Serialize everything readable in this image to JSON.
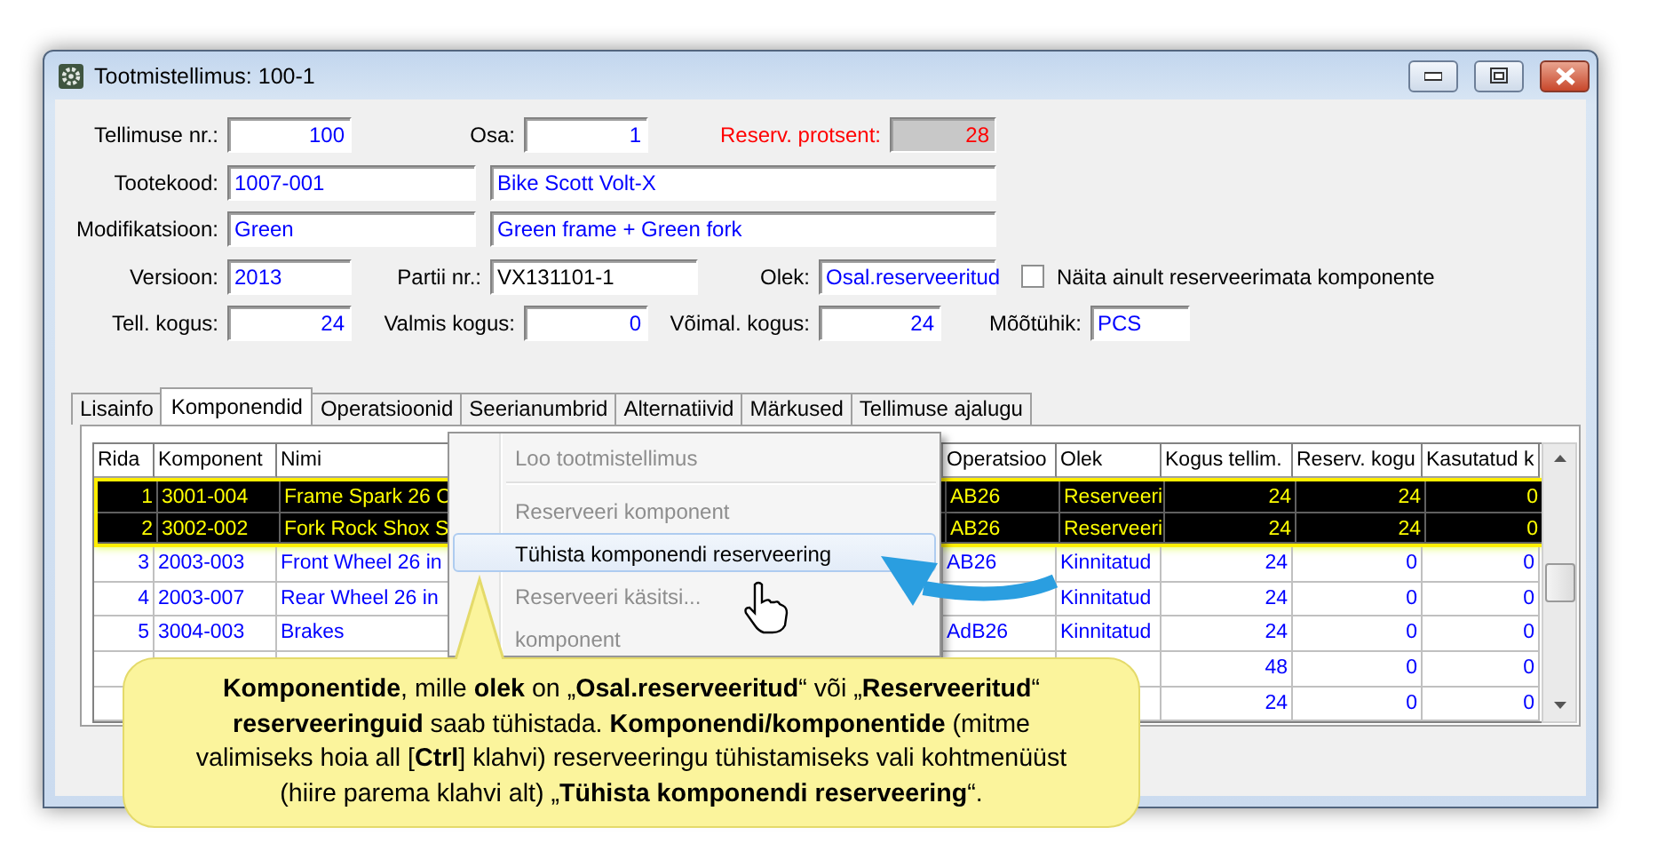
{
  "window": {
    "title": "Tootmistellimus: 100-1"
  },
  "header": {
    "order_no": {
      "label": "Tellimuse nr.:",
      "value": "100"
    },
    "part": {
      "label": "Osa:",
      "value": "1"
    },
    "reserve_percent": {
      "label": "Reserv. protsent:",
      "value": "28"
    },
    "product_code": {
      "label": "Tootekood:",
      "value": "1007-001"
    },
    "product_name": {
      "value": "Bike Scott Volt-X"
    },
    "modification": {
      "label": "Modifikatsioon:",
      "value": "Green"
    },
    "modification_desc": {
      "value": "Green frame + Green fork"
    },
    "version": {
      "label": "Versioon:",
      "value": "2013"
    },
    "batch_no": {
      "label": "Partii nr.:",
      "value": "VX131101-1"
    },
    "status": {
      "label": "Olek:",
      "value": "Osal.reserveeritud"
    },
    "show_unreserved_only": {
      "label": "Näita ainult reserveerimata komponente",
      "checked": false
    },
    "ordered_qty": {
      "label": "Tell. kogus:",
      "value": "24"
    },
    "finished_qty": {
      "label": "Valmis kogus:",
      "value": "0"
    },
    "available_qty": {
      "label": "Võimal. kogus:",
      "value": "24"
    },
    "unit": {
      "label": "Mõõtühik:",
      "value": "PCS"
    }
  },
  "tabs": [
    {
      "label": "Lisainfo",
      "selected": false
    },
    {
      "label": "Komponendid",
      "selected": true
    },
    {
      "label": "Operatsioonid",
      "selected": false
    },
    {
      "label": "Seerianumbrid",
      "selected": false
    },
    {
      "label": "Alternatiivid",
      "selected": false
    },
    {
      "label": "Märkused",
      "selected": false
    },
    {
      "label": "Tellimuse ajalugu",
      "selected": false
    }
  ],
  "grid": {
    "columns": [
      "Rida",
      "Komponent",
      "Nimi",
      "Operatsioo",
      "Olek",
      "Kogus tellim.",
      "Reserv. kogu",
      "Kasutatud k"
    ],
    "rows": [
      {
        "selected": true,
        "row_no": "1",
        "component": "3001-004",
        "name": "Frame Spark 26 C",
        "operation": "AB26",
        "status": "Reserveeri",
        "ordered": "24",
        "reserved": "24",
        "used": "0"
      },
      {
        "selected": true,
        "row_no": "2",
        "component": "3002-002",
        "name": "Fork Rock Shox S",
        "operation": "AB26",
        "status": "Reserveeri",
        "ordered": "24",
        "reserved": "24",
        "used": "0"
      },
      {
        "selected": false,
        "row_no": "3",
        "component": "2003-003",
        "name": "Front Wheel 26 in",
        "operation": "AB26",
        "status": "Kinnitatud",
        "ordered": "24",
        "reserved": "0",
        "used": "0"
      },
      {
        "selected": false,
        "row_no": "4",
        "component": "2003-007",
        "name": "Rear Wheel 26 in",
        "status": "Kinnitatud",
        "ordered": "24",
        "reserved": "0",
        "used": "0"
      },
      {
        "selected": false,
        "row_no": "5",
        "component": "3004-003",
        "name": "Brakes",
        "operation": "AdB26",
        "status": "Kinnitatud",
        "ordered": "24",
        "reserved": "0",
        "used": "0"
      },
      {
        "selected": false,
        "ordered": "48",
        "reserved": "0",
        "used": "0"
      },
      {
        "selected": false,
        "ordered": "24",
        "reserved": "0",
        "used": "0"
      }
    ]
  },
  "context_menu": {
    "items": [
      {
        "kind": "item",
        "label": "Loo tootmistellimus",
        "disabled": true,
        "selected": false
      },
      {
        "kind": "separator"
      },
      {
        "kind": "item",
        "label": "Reserveeri komponent",
        "disabled": true,
        "selected": false
      },
      {
        "kind": "item",
        "label": "Tühista komponendi reserveering",
        "disabled": false,
        "selected": true
      },
      {
        "kind": "item",
        "label": "Reserveeri käsitsi...",
        "disabled": true,
        "selected": false
      },
      {
        "kind": "item",
        "label": "komponent",
        "disabled": true,
        "selected": false
      }
    ]
  },
  "callout": {
    "text": "**Komponentide**, mille **olek** on „**Osal.reserveeritud**“ või „**Reserveeritud**“ **reserveeringuid** saab tühistada.  **Komponendi/komponentide** (mitme valimiseks hoia all [**Ctrl**] klahvi) reserveeringu tühistamiseks vali kohtmenüüst (hiire parema klahvi alt) „**Tühista komponendi reserveering**“."
  }
}
